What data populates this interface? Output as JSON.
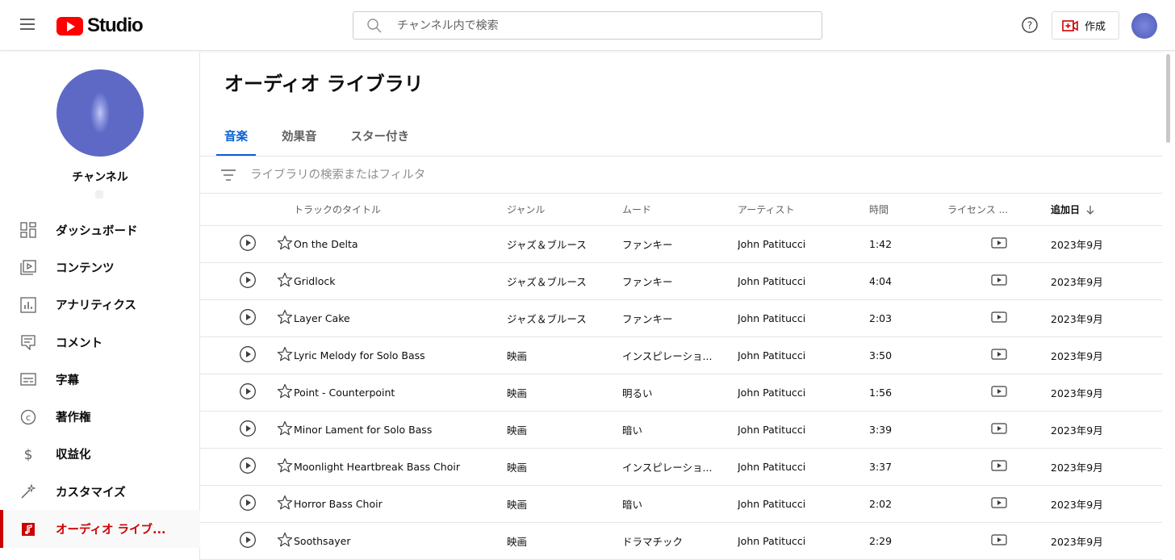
{
  "header": {
    "logo_text": "Studio",
    "search_placeholder": "チャンネル内で検索",
    "create_label": "作成"
  },
  "sidebar": {
    "channel_name": "チャンネル",
    "items": [
      {
        "label": "ダッシュボード",
        "icon": "dashboard-icon"
      },
      {
        "label": "コンテンツ",
        "icon": "content-icon"
      },
      {
        "label": "アナリティクス",
        "icon": "analytics-icon"
      },
      {
        "label": "コメント",
        "icon": "comment-icon"
      },
      {
        "label": "字幕",
        "icon": "subtitles-icon"
      },
      {
        "label": "著作権",
        "icon": "copyright-icon"
      },
      {
        "label": "収益化",
        "icon": "dollar-icon"
      },
      {
        "label": "カスタマイズ",
        "icon": "magic-wand-icon"
      },
      {
        "label": "オーディオ ライブ...",
        "icon": "audio-library-icon"
      }
    ],
    "active_index": 8
  },
  "main": {
    "title": "オーディオ ライブラリ",
    "tabs": [
      {
        "label": "音楽"
      },
      {
        "label": "効果音"
      },
      {
        "label": "スター付き"
      }
    ],
    "active_tab": 0,
    "filter_placeholder": "ライブラリの検索またはフィルタ"
  },
  "table": {
    "headers": {
      "title": "トラックのタイトル",
      "genre": "ジャンル",
      "mood": "ムード",
      "artist": "アーティスト",
      "duration": "時間",
      "license": "ライセンス ...",
      "added": "追加日"
    },
    "rows": [
      {
        "title": "On the Delta",
        "genre": "ジャズ＆ブルース",
        "mood": "ファンキー",
        "artist": "John Patitucci",
        "duration": "1:42",
        "added": "2023年9月"
      },
      {
        "title": "Gridlock",
        "genre": "ジャズ＆ブルース",
        "mood": "ファンキー",
        "artist": "John Patitucci",
        "duration": "4:04",
        "added": "2023年9月"
      },
      {
        "title": "Layer Cake",
        "genre": "ジャズ＆ブルース",
        "mood": "ファンキー",
        "artist": "John Patitucci",
        "duration": "2:03",
        "added": "2023年9月"
      },
      {
        "title": "Lyric Melody for Solo Bass",
        "genre": "映画",
        "mood": "インスピレーショ...",
        "artist": "John Patitucci",
        "duration": "3:50",
        "added": "2023年9月"
      },
      {
        "title": "Point - Counterpoint",
        "genre": "映画",
        "mood": "明るい",
        "artist": "John Patitucci",
        "duration": "1:56",
        "added": "2023年9月"
      },
      {
        "title": "Minor Lament for Solo Bass",
        "genre": "映画",
        "mood": "暗い",
        "artist": "John Patitucci",
        "duration": "3:39",
        "added": "2023年9月"
      },
      {
        "title": "Moonlight Heartbreak Bass Choir",
        "genre": "映画",
        "mood": "インスピレーショ...",
        "artist": "John Patitucci",
        "duration": "3:37",
        "added": "2023年9月"
      },
      {
        "title": "Horror Bass Choir",
        "genre": "映画",
        "mood": "暗い",
        "artist": "John Patitucci",
        "duration": "2:02",
        "added": "2023年9月"
      },
      {
        "title": "Soothsayer",
        "genre": "映画",
        "mood": "ドラマチック",
        "artist": "John Patitucci",
        "duration": "2:29",
        "added": "2023年9月"
      }
    ]
  },
  "colors": {
    "accent_red": "#cc0000",
    "tab_blue": "#065fd4",
    "logo_red": "#ff0000"
  }
}
